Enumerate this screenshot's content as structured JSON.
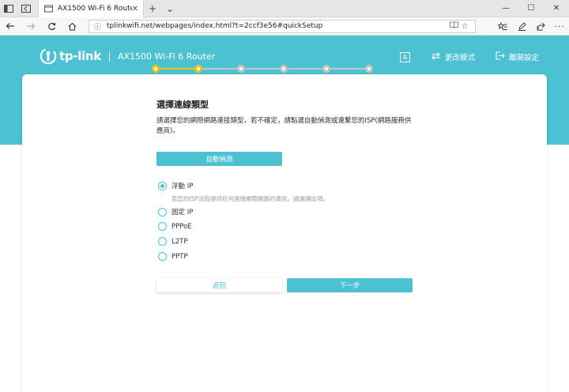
{
  "browser": {
    "tab_title": "AX1500 Wi-Fi 6 Router",
    "tab_close": "✕",
    "new_tab": "+",
    "tab_menu": "⌄",
    "url": "tplinkwifi.net/webpages/index.html?t=2ccf3e56#quickSetup",
    "window_min": "—",
    "window_max": "☐",
    "window_close": "✕"
  },
  "header": {
    "logo_text": "tp-link",
    "model": "AX1500 Wi-Fi 6 Router",
    "lang_icon_letter": "A",
    "change_mode_label": "更改模式",
    "logout_label": "離開設定"
  },
  "wizard": {
    "total_steps": 6,
    "current_step": 2,
    "active_color": "#f2c200",
    "inactive_color": "#c4c4c4"
  },
  "content": {
    "title": "選擇連線類型",
    "description": "請選擇您的網際網路連接類型，若不確定，請點選自動偵測或連繫您的ISP(網路服務供應商)。",
    "auto_detect_label": "自動偵測",
    "options": [
      {
        "label": "浮動 IP",
        "selected": true
      },
      {
        "label": "固定 IP",
        "selected": false
      },
      {
        "label": "PPPoE",
        "selected": false
      },
      {
        "label": "L2TP",
        "selected": false
      },
      {
        "label": "PPTP",
        "selected": false
      }
    ],
    "dynamic_ip_hint": "若您的ISP沒有提供任何連接網際網路的資訊，請選擇此項。",
    "back_label": "返回",
    "next_label": "下一步"
  },
  "colors": {
    "brand": "#4bc1d2"
  }
}
